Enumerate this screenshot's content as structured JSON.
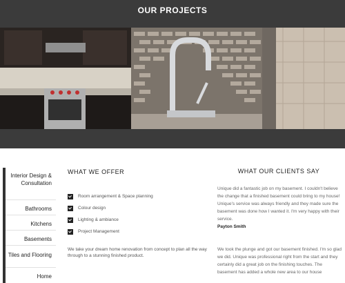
{
  "header": {
    "title": "OUR PROJECTS"
  },
  "gallery": [
    {
      "name": "Dark kitchen cabinets with stainless range"
    },
    {
      "name": "Chrome faucet with mosaic tile backsplash"
    },
    {
      "name": "Tiled bathroom wall"
    }
  ],
  "sidebar": {
    "items": [
      {
        "label": "Interior Design & Consultation",
        "active": true
      },
      {
        "label": "Bathrooms"
      },
      {
        "label": "Kitchens"
      },
      {
        "label": "Basements"
      },
      {
        "label": "Tiles and Flooring"
      },
      {
        "label": "Home"
      }
    ]
  },
  "offer": {
    "title": "WHAT WE OFFER",
    "items": [
      "Room arrangement & Space planning",
      "Colour design",
      "Lighting & ambiance",
      "Project Management"
    ],
    "paragraph": "We take your dream home renovation from concept to plan all the way through to a  stunning finished product."
  },
  "clients": {
    "title": "WHAT OUR CLIENTS SAY",
    "testimonials": [
      {
        "text": "Unique did a fantastic job on my basement. I couldn't believe the change that a finished basement could bring to my house! Unique's service was always friendly and they made sure the basement was done how I wanted it. I'm very happy with their service.",
        "author": "Payton Smith"
      },
      {
        "text": "We took the plunge and got our basement finished. I'm so glad we did. Unique was professional right from the start and they certainly did a great job on the finishing touches. The basement has added a whole new area to our house",
        "author": ""
      }
    ]
  },
  "colors": {
    "dark_band": "#3b3b3b",
    "text_dark": "#222222",
    "text_muted": "#666666"
  }
}
